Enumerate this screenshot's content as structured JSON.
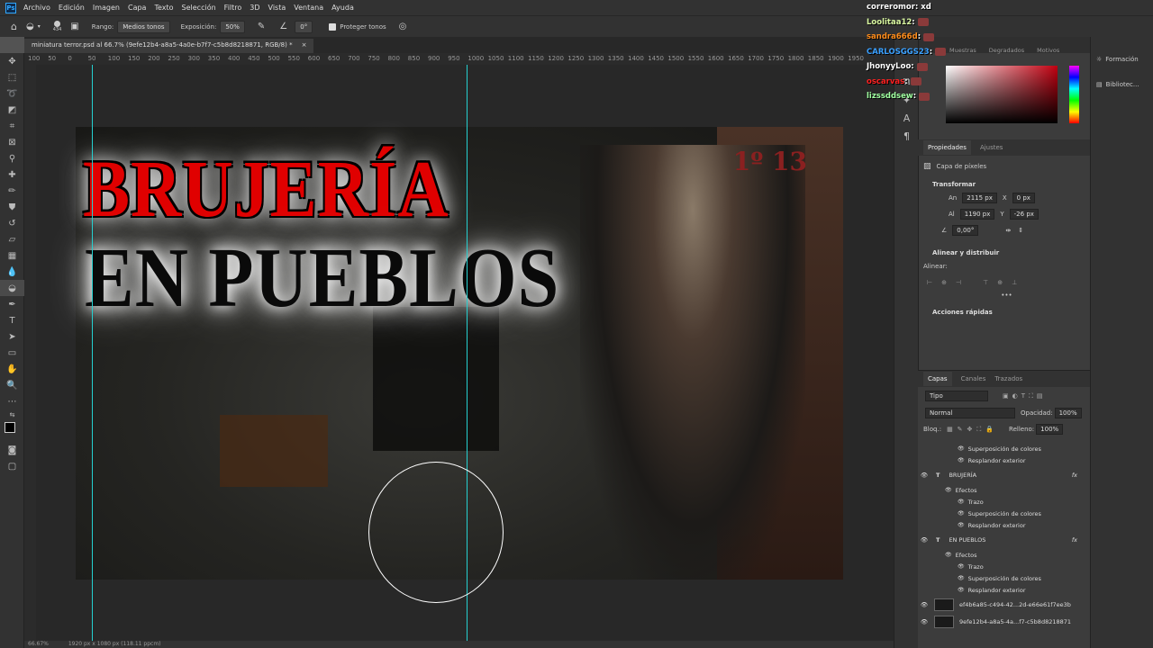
{
  "menu": [
    "Archivo",
    "Edición",
    "Imagen",
    "Capa",
    "Texto",
    "Selección",
    "Filtro",
    "3D",
    "Vista",
    "Ventana",
    "Ayuda"
  ],
  "options": {
    "brush_size": "434",
    "range_label": "Rango:",
    "range_value": "Medios tonos",
    "exposure_label": "Exposición:",
    "exposure_value": "50%",
    "angle_value": "0°",
    "protect_label": "Proteger tonos"
  },
  "doc_tab": {
    "title": "miniatura terror.psd al 66.7% (9efe12b4-a8a5-4a0e-b7f7-c5b8d8218871, RGB/8) *",
    "close": "×"
  },
  "ruler_ticks": [
    "100",
    "50",
    "0",
    "50",
    "100",
    "150",
    "200",
    "250",
    "300",
    "350",
    "400",
    "450",
    "500",
    "550",
    "600",
    "650",
    "700",
    "750",
    "800",
    "850",
    "900",
    "950",
    "1000",
    "1050",
    "1100",
    "1150",
    "1200",
    "1250",
    "1300",
    "1350",
    "1400",
    "1450",
    "1500",
    "1550",
    "1600",
    "1650",
    "1700",
    "1750",
    "1800",
    "1850",
    "1900",
    "1950"
  ],
  "canvas": {
    "title_line1": "BRUJERÍA",
    "title_line2": "EN PUEBLOS",
    "room_number": "1º 13"
  },
  "status": {
    "zoom": "66.67%",
    "size": "1920 px x 1080 px (118.11 ppcm)"
  },
  "chat": [
    {
      "user": "correromor",
      "text": ": xd",
      "color": "#ffffff"
    },
    {
      "user": "Loolitaa12",
      "text": ":",
      "color": "#d9f7a0"
    },
    {
      "user": "sandra666d",
      "text": ":",
      "color": "#ff8c1a"
    },
    {
      "user": "CARLOSGGS23",
      "text": ":",
      "color": "#3aa0ff"
    },
    {
      "user": "JhonyyLoo",
      "text": ":",
      "color": "#ffffff"
    },
    {
      "user": "oscarvas",
      "text": ":",
      "color": "#ff2020"
    },
    {
      "user": "lizssddsew",
      "text": ":",
      "color": "#a0ffa0"
    }
  ],
  "color_tabs": [
    "Muestras",
    "Degradados",
    "Motivos"
  ],
  "far_right": {
    "item1": "Formación",
    "item2": "Bibliotec..."
  },
  "properties": {
    "tabs": [
      "Propiedades",
      "Ajustes"
    ],
    "layer_type": "Capa de píxeles",
    "transform_label": "Transformar",
    "w_label": "An",
    "w_value": "2115 px",
    "x_label": "X",
    "x_value": "0 px",
    "h_label": "Al",
    "h_value": "1190 px",
    "y_label": "Y",
    "y_value": "-26 px",
    "angle": "0,00°",
    "align_label": "Alinear y distribuir",
    "align_sub": "Alinear:",
    "more": "•••",
    "quick_label": "Acciones rápidas"
  },
  "layers": {
    "tabs": [
      "Capas",
      "Canales",
      "Trazados"
    ],
    "filter": "Tipo",
    "blend": "Normal",
    "opacity_label": "Opacidad:",
    "opacity_value": "100%",
    "lock_label": "Bloq.:",
    "fill_label": "Relleno:",
    "fill_value": "100%",
    "items": [
      {
        "kind": "fx",
        "name": "Superposición de colores"
      },
      {
        "kind": "fx",
        "name": "Resplandor exterior"
      },
      {
        "kind": "text",
        "name": "BRUJERÍA"
      },
      {
        "kind": "fxhead",
        "name": "Efectos"
      },
      {
        "kind": "fx",
        "name": "Trazo"
      },
      {
        "kind": "fx",
        "name": "Superposición de colores"
      },
      {
        "kind": "fx",
        "name": "Resplandor exterior"
      },
      {
        "kind": "text",
        "name": "EN PUEBLOS"
      },
      {
        "kind": "fxhead",
        "name": "Efectos"
      },
      {
        "kind": "fx",
        "name": "Trazo"
      },
      {
        "kind": "fx",
        "name": "Superposición de colores"
      },
      {
        "kind": "fx",
        "name": "Resplandor exterior"
      },
      {
        "kind": "img",
        "name": "ef4b6a85-c494-42...2d-e66e61f7ee3b"
      },
      {
        "kind": "img",
        "name": "9efe12b4-a8a5-4a...f7-c5b8d8218871"
      }
    ]
  }
}
